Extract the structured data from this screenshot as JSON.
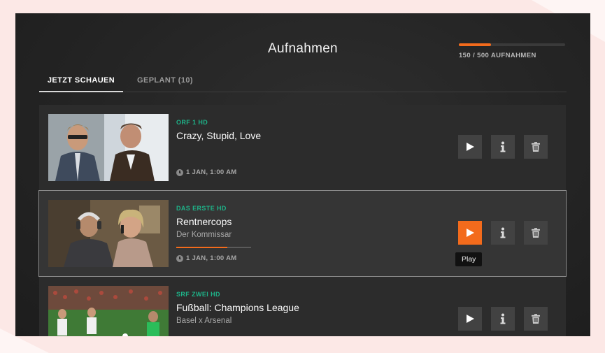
{
  "page": {
    "title": "Aufnahmen"
  },
  "quota": {
    "used": 150,
    "total": 500,
    "label": "150 / 500 AUFNAHMEN"
  },
  "tabs": [
    {
      "label": "JETZT SCHAUEN",
      "active": true
    },
    {
      "label": "GEPLANT (10)",
      "active": false
    }
  ],
  "recordings": [
    {
      "channel": "ORF 1 HD",
      "title": "Crazy, Stupid, Love",
      "subtitle": "",
      "progress": null,
      "time": "1 JAN, 1:00 AM",
      "focused": false
    },
    {
      "channel": "DAS ERSTE HD",
      "title": "Rentnercops",
      "subtitle": "Der Kommissar",
      "progress": 0.68,
      "time": "1 JAN, 1:00 AM",
      "focused": true
    },
    {
      "channel": "SRF ZWEI HD",
      "title": "Fußball: Champions League",
      "subtitle": "Basel x Arsenal",
      "progress": null,
      "time": "",
      "focused": false
    }
  ],
  "actions": {
    "play_icon": "play-icon",
    "info_icon": "info-icon",
    "delete_icon": "trash-icon"
  },
  "tooltip": {
    "label": "Play"
  },
  "colors": {
    "accent": "#f36b1c",
    "channel": "#1eb389",
    "panel": "#2c2c2c",
    "background": "#242424"
  }
}
